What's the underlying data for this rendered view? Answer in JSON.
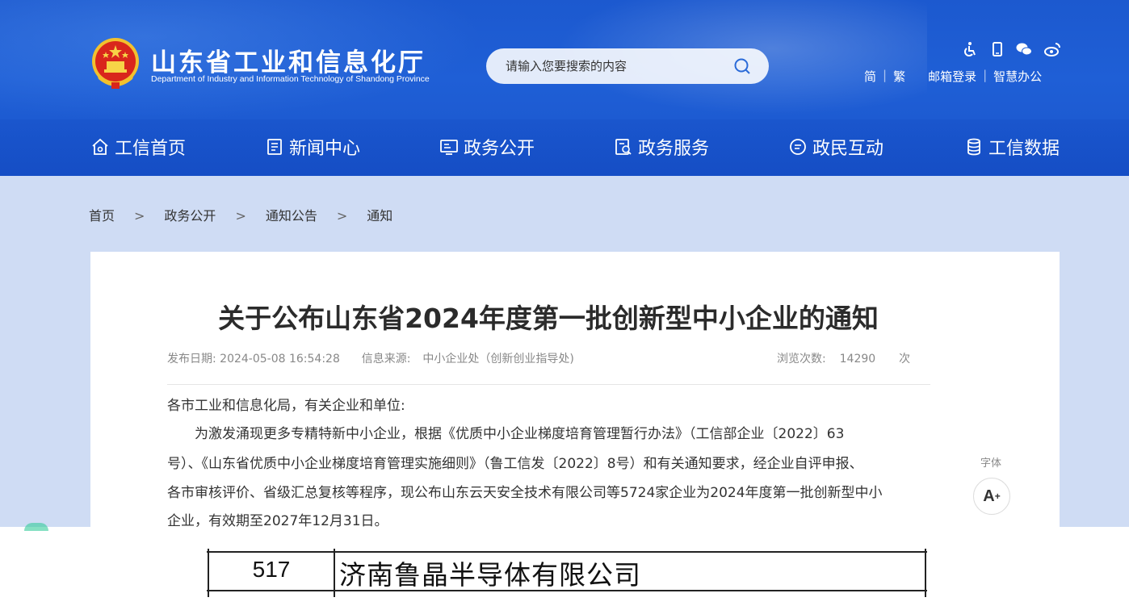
{
  "header": {
    "site_title": "山东省工业和信息化厅",
    "site_subtitle": "Department of Industry and Information Technology of Shandong Province",
    "search": {
      "placeholder": "请输入您要搜索的内容"
    },
    "tools": [
      "accessibility-icon",
      "mobile-icon",
      "wechat-icon",
      "weibo-icon"
    ],
    "links": {
      "simplified": "简",
      "traditional": "繁",
      "mail_login": "邮箱登录",
      "smart_office": "智慧办公"
    }
  },
  "nav": [
    {
      "label": "工信首页",
      "icon": "home-icon"
    },
    {
      "label": "新闻中心",
      "icon": "news-icon"
    },
    {
      "label": "政务公开",
      "icon": "gov-open-icon"
    },
    {
      "label": "政务服务",
      "icon": "gov-service-icon"
    },
    {
      "label": "政民互动",
      "icon": "interaction-icon"
    },
    {
      "label": "工信数据",
      "icon": "database-icon"
    }
  ],
  "breadcrumb": {
    "items": [
      "首页",
      "政务公开",
      "通知公告",
      "通知"
    ],
    "separator": ">"
  },
  "article": {
    "title": "关于公布山东省2024年度第一批创新型中小企业的通知",
    "publish_label": "发布日期:",
    "publish_date": "2024-05-08 16:54:28",
    "source_label": "信息来源:",
    "source": "中小企业处（创新创业指导处)",
    "views_label": "浏览次数:",
    "views": "14290",
    "views_unit": "次",
    "salutation": "各市工业和信息化局，有关企业和单位:",
    "paragraph_lines": [
      "为激发涌现更多专精特新中小企业，根据《优质中小企业梯度培育管理暂行办法》（工信部企业〔2022〕63",
      "号）、《山东省优质中小企业梯度培育管理实施细则》（鲁工信发〔2022〕8号）和有关通知要求，经企业自评申报、",
      "各市审核评价、省级汇总复核等程序，现公布山东云天安全技术有限公司等5724家企业为2024年度第一批创新型中小",
      "企业，有效期至2027年12月31日。"
    ]
  },
  "font_tool": {
    "label": "字体",
    "button": "A"
  },
  "table_row": {
    "number": "517",
    "company": "济南鲁晶半导体有限公司"
  },
  "colors": {
    "header_blue": "#1c59cf",
    "crumb_bg": "#cfdcf4"
  }
}
